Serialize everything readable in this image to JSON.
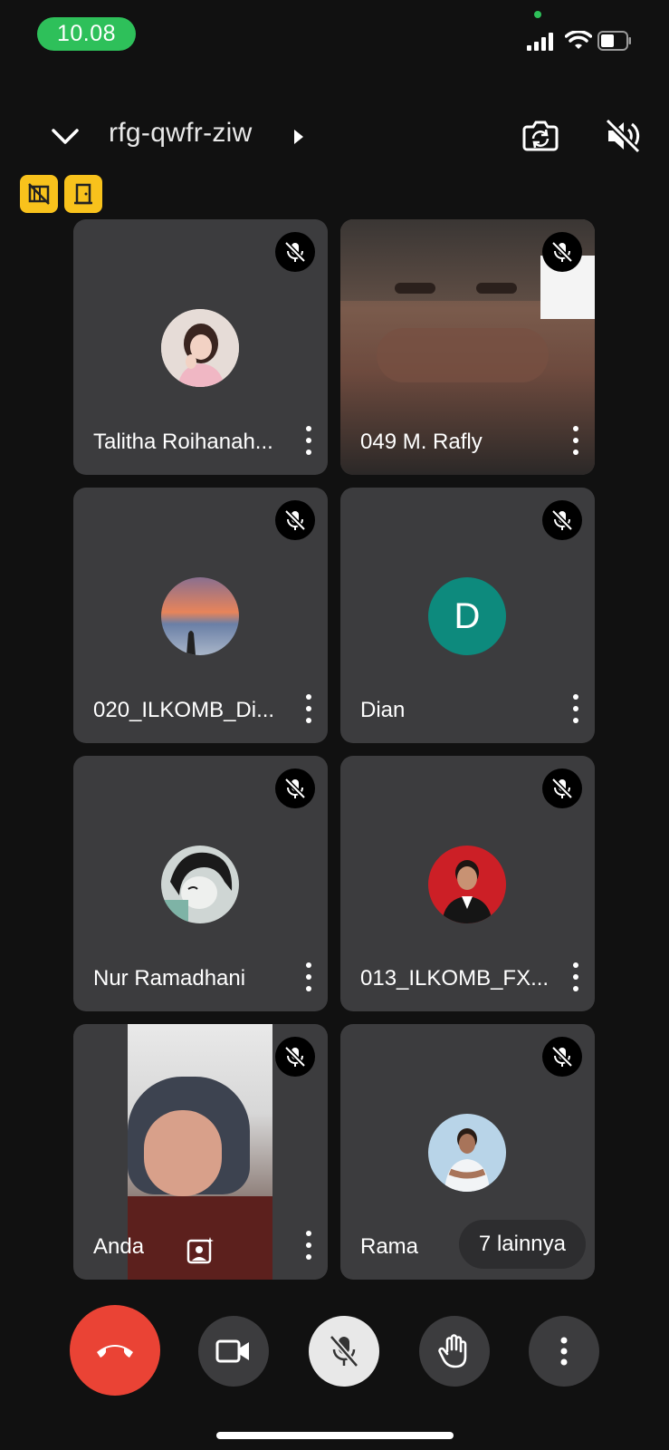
{
  "status_bar": {
    "time": "10.08"
  },
  "header": {
    "meeting_code": "rfg-qwfr-ziw"
  },
  "participants": [
    {
      "name": "Talitha Roihanah...",
      "avatar_type": "photo"
    },
    {
      "name": "049 M. Rafly",
      "avatar_type": "video"
    },
    {
      "name": "020_ILKOMB_Di...",
      "avatar_type": "photo"
    },
    {
      "name": "Dian",
      "avatar_type": "letter",
      "letter": "D",
      "color": "#0d8a7d"
    },
    {
      "name": "Nur Ramadhani",
      "avatar_type": "photo"
    },
    {
      "name": "013_ILKOMB_FX...",
      "avatar_type": "photo"
    },
    {
      "name": "Anda",
      "avatar_type": "video"
    },
    {
      "name": "Rama",
      "avatar_type": "photo"
    }
  ],
  "others_pill": "7 lainnya",
  "controls": [
    "end-call",
    "camera",
    "microphone-muted",
    "raise-hand",
    "more-options"
  ],
  "colors": {
    "end_call": "#ea4335",
    "badge": "#f8c21c",
    "tile": "#3c3c3e",
    "status_green": "#2ec05a"
  }
}
